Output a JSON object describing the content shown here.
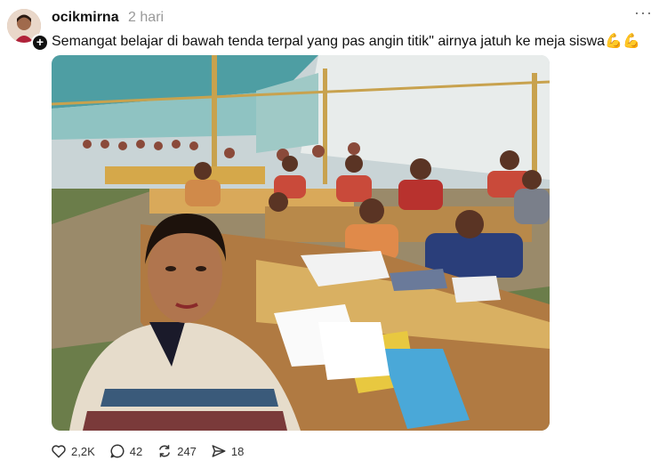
{
  "post": {
    "username": "ocikmirna",
    "time": "2 hari",
    "caption": "Semangat belajar di bawah tenda terpal yang pas angin titik\" airnya jatuh ke meja siswa",
    "caption_emoji": "💪💪",
    "more_icon": "more-icon",
    "follow_icon": "plus-icon"
  },
  "actions": {
    "likes": "2,2K",
    "comments": "42",
    "reposts": "247",
    "shares": "18"
  }
}
